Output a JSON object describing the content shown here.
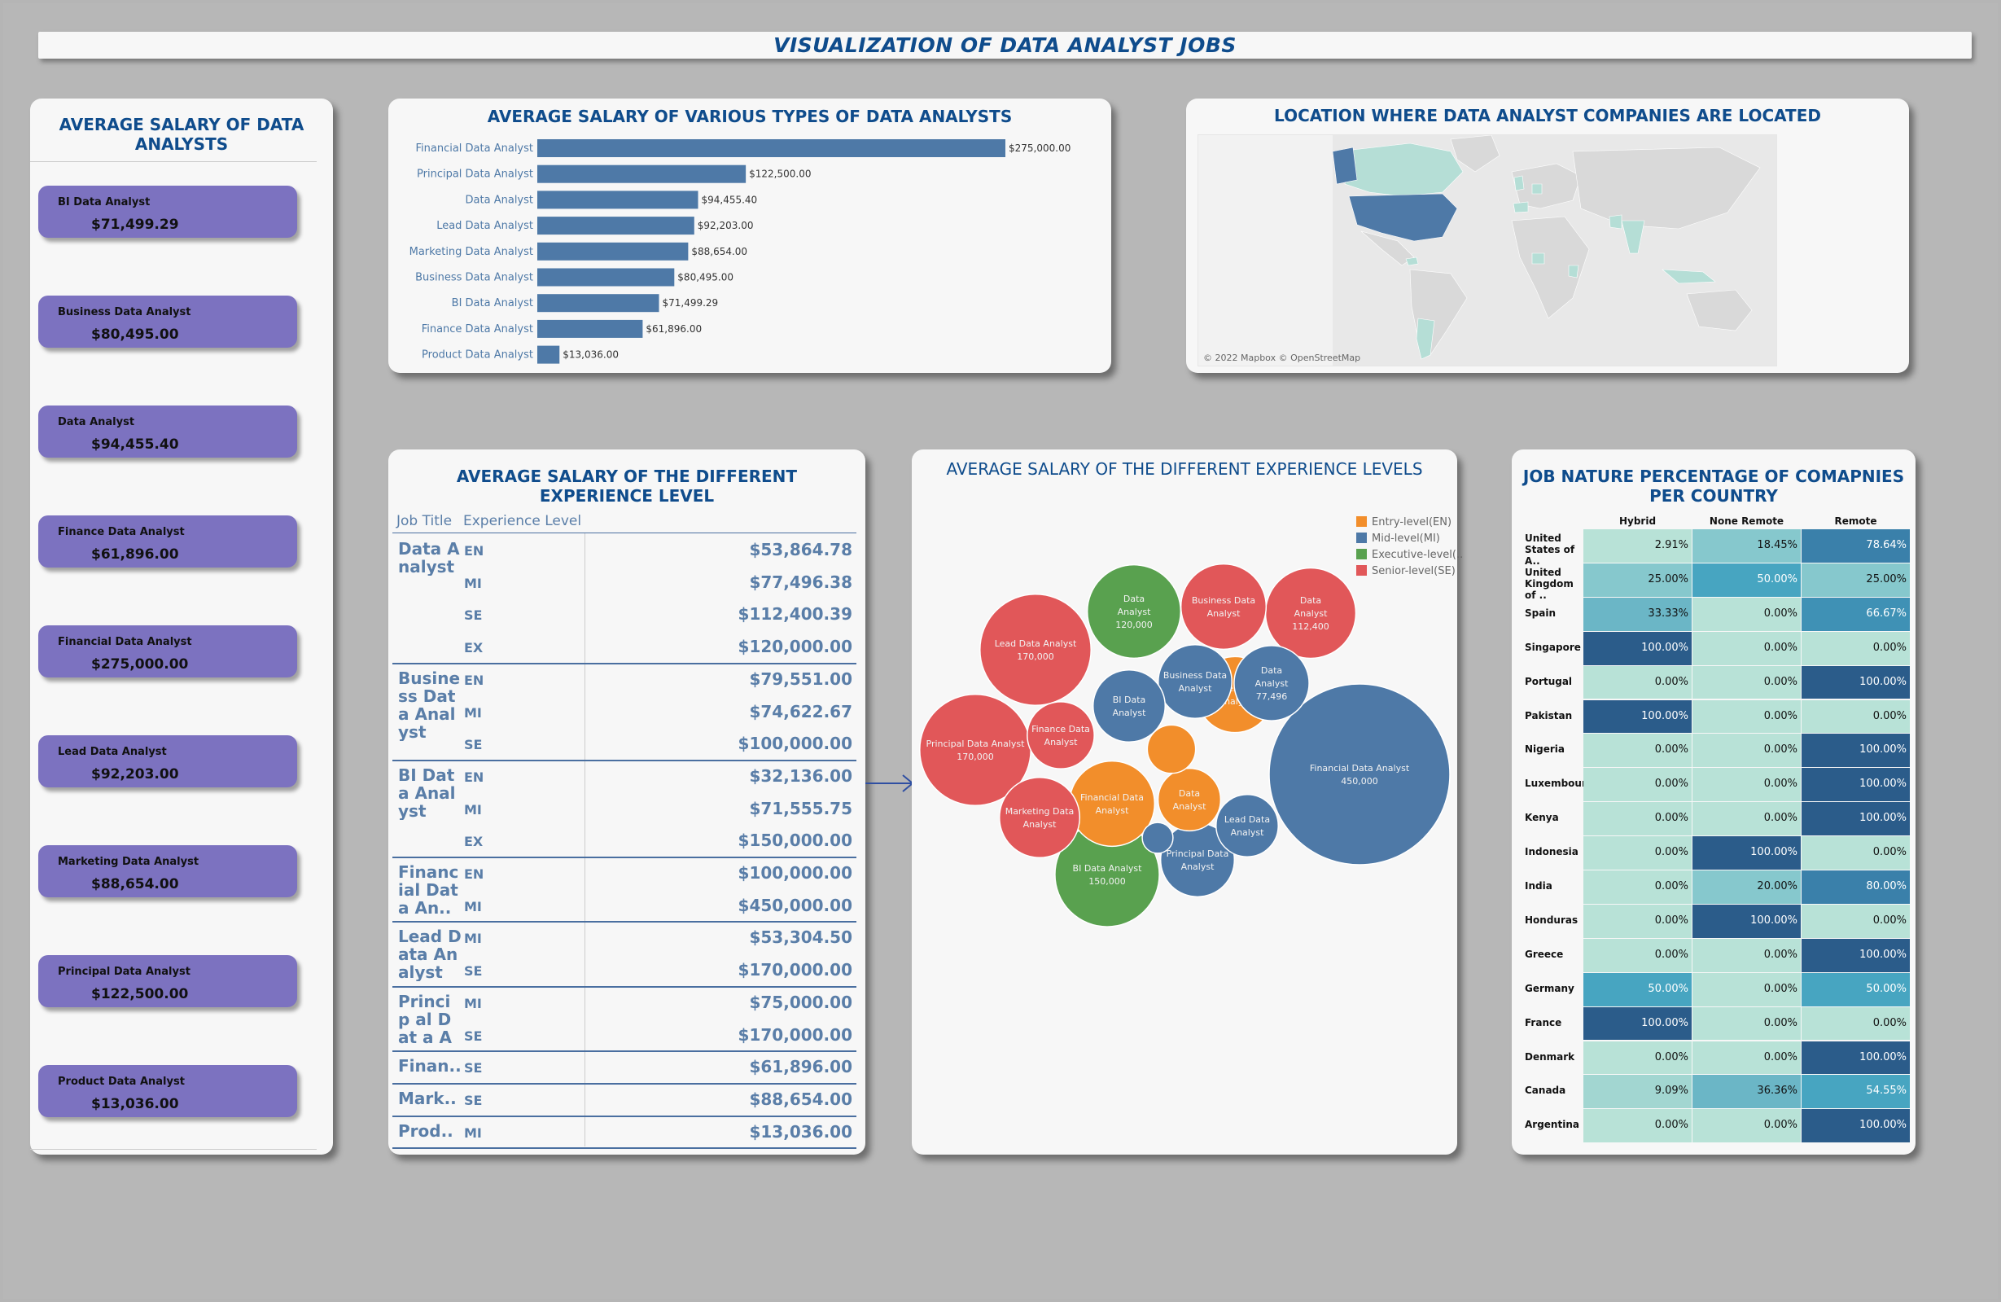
{
  "dashboard_title": "VISUALIZATION OF DATA ANALYST JOBS",
  "left_panel": {
    "title": "AVERAGE SALARY OF DATA ANALYSTS",
    "cards": [
      {
        "name": "BI Data Analyst",
        "value": "$71,499.29"
      },
      {
        "name": "Business Data Analyst",
        "value": "$80,495.00"
      },
      {
        "name": "Data Analyst",
        "value": "$94,455.40"
      },
      {
        "name": "Finance Data Analyst",
        "value": "$61,896.00"
      },
      {
        "name": "Financial Data Analyst",
        "value": "$275,000.00"
      },
      {
        "name": "Lead Data Analyst",
        "value": "$92,203.00"
      },
      {
        "name": "Marketing Data Analyst",
        "value": "$88,654.00"
      },
      {
        "name": "Principal Data Analyst",
        "value": "$122,500.00"
      },
      {
        "name": "Product Data Analyst",
        "value": "$13,036.00"
      }
    ]
  },
  "bar_panel": {
    "title": "AVERAGE SALARY OF VARIOUS TYPES OF DATA ANALYSTS"
  },
  "chart_data": [
    {
      "type": "bar",
      "orientation": "horizontal",
      "title": "AVERAGE SALARY OF VARIOUS TYPES OF DATA ANALYSTS",
      "categories": [
        "Financial Data Analyst",
        "Principal Data Analyst",
        "Data Analyst",
        "Lead Data Analyst",
        "Marketing Data Analyst",
        "Business Data Analyst",
        "BI Data Analyst",
        "Finance Data Analyst",
        "Product Data Analyst"
      ],
      "values": [
        275000,
        122500,
        94455.4,
        92203,
        88654,
        80495,
        71499.29,
        61896,
        13036
      ],
      "value_labels": [
        "$275,000.00",
        "$122,500.00",
        "$94,455.40",
        "$92,203.00",
        "$88,654.00",
        "$80,495.00",
        "$71,499.29",
        "$61,896.00",
        "$13,036.00"
      ],
      "color": "#4e79a7",
      "xlim": [
        0,
        275000
      ]
    },
    {
      "type": "scatter",
      "subtype": "packed-bubble",
      "title": "AVERAGE SALARY OF THE DIFFERENT EXPERIENCE LEVELS",
      "legend": [
        {
          "label": "Entry-level(EN)",
          "color": "#f28e2b"
        },
        {
          "label": "Mid-level(MI)",
          "color": "#4e79a7"
        },
        {
          "label": "Executive-level(..",
          "color": "#59a14f"
        },
        {
          "label": "Senior-level(SE)",
          "color": "#e15759"
        }
      ],
      "legend_position": "top-right",
      "bubbles": [
        {
          "label": "Financial Data Analyst",
          "value_label": "450,000",
          "value": 450000,
          "level": "MI"
        },
        {
          "label": "Principal Data Analyst",
          "value_label": "170,000",
          "value": 170000,
          "level": "SE"
        },
        {
          "label": "Lead Data Analyst",
          "value_label": "170,000",
          "value": 170000,
          "level": "SE"
        },
        {
          "label": "BI Data Analyst",
          "value_label": "150,000",
          "value": 150000,
          "level": "EX"
        },
        {
          "label": "Data Analyst",
          "value_label": "120,000",
          "value": 120000,
          "level": "EX"
        },
        {
          "label": "Data Analyst",
          "value_label": "112,400",
          "value": 112400,
          "level": "SE"
        },
        {
          "label": "Business Data Analyst",
          "value_label": "",
          "value": 100000,
          "level": "SE"
        },
        {
          "label": "Financial Data Analyst",
          "value_label": "",
          "value": 100000,
          "level": "EN"
        },
        {
          "label": "Business Data Analyst",
          "value_label": "",
          "value": 79551,
          "level": "EN"
        },
        {
          "label": "Data Analyst",
          "value_label": "77,496",
          "value": 77496,
          "level": "MI"
        },
        {
          "label": "Principal Data Analyst",
          "value_label": "",
          "value": 75000,
          "level": "MI"
        },
        {
          "label": "Business Data Analyst",
          "value_label": "",
          "value": 74623,
          "level": "MI"
        },
        {
          "label": "BI Data Analyst",
          "value_label": "",
          "value": 71556,
          "level": "MI"
        },
        {
          "label": "Marketing Data Analyst",
          "value_label": "",
          "value": 88654,
          "level": "SE"
        },
        {
          "label": "Finance Data Analyst",
          "value_label": "",
          "value": 61896,
          "level": "SE"
        },
        {
          "label": "Lead Data Analyst",
          "value_label": "",
          "value": 53305,
          "level": "MI"
        },
        {
          "label": "Data Analyst",
          "value_label": "",
          "value": 53865,
          "level": "EN"
        },
        {
          "label": "",
          "value_label": "",
          "value": 32136,
          "level": "EN"
        },
        {
          "label": "",
          "value_label": "",
          "value": 13036,
          "level": "MI"
        }
      ]
    },
    {
      "type": "heatmap",
      "title": "JOB NATURE PERCENTAGE OF COMAPNIES PER COUNTRY",
      "columns": [
        "Hybrid",
        "None Remote",
        "Remote"
      ],
      "rows": [
        {
          "country": "United States of A..",
          "values": [
            2.91,
            18.45,
            78.64
          ],
          "labels": [
            "2.91%",
            "18.45%",
            "78.64%"
          ]
        },
        {
          "country": "United Kingdom of ..",
          "values": [
            25.0,
            50.0,
            25.0
          ],
          "labels": [
            "25.00%",
            "50.00%",
            "25.00%"
          ]
        },
        {
          "country": "Spain",
          "values": [
            33.33,
            0.0,
            66.67
          ],
          "labels": [
            "33.33%",
            "0.00%",
            "66.67%"
          ]
        },
        {
          "country": "Singapore",
          "values": [
            100.0,
            0.0,
            0.0
          ],
          "labels": [
            "100.00%",
            "0.00%",
            "0.00%"
          ]
        },
        {
          "country": "Portugal",
          "values": [
            0.0,
            0.0,
            100.0
          ],
          "labels": [
            "0.00%",
            "0.00%",
            "100.00%"
          ]
        },
        {
          "country": "Pakistan",
          "values": [
            100.0,
            0.0,
            0.0
          ],
          "labels": [
            "100.00%",
            "0.00%",
            "0.00%"
          ]
        },
        {
          "country": "Nigeria",
          "values": [
            0.0,
            0.0,
            100.0
          ],
          "labels": [
            "0.00%",
            "0.00%",
            "100.00%"
          ]
        },
        {
          "country": "Luxembourg",
          "values": [
            0.0,
            0.0,
            100.0
          ],
          "labels": [
            "0.00%",
            "0.00%",
            "100.00%"
          ]
        },
        {
          "country": "Kenya",
          "values": [
            0.0,
            0.0,
            100.0
          ],
          "labels": [
            "0.00%",
            "0.00%",
            "100.00%"
          ]
        },
        {
          "country": "Indonesia",
          "values": [
            0.0,
            100.0,
            0.0
          ],
          "labels": [
            "0.00%",
            "100.00%",
            "0.00%"
          ]
        },
        {
          "country": "India",
          "values": [
            0.0,
            20.0,
            80.0
          ],
          "labels": [
            "0.00%",
            "20.00%",
            "80.00%"
          ]
        },
        {
          "country": "Honduras",
          "values": [
            0.0,
            100.0,
            0.0
          ],
          "labels": [
            "0.00%",
            "100.00%",
            "0.00%"
          ]
        },
        {
          "country": "Greece",
          "values": [
            0.0,
            0.0,
            100.0
          ],
          "labels": [
            "0.00%",
            "0.00%",
            "100.00%"
          ]
        },
        {
          "country": "Germany",
          "values": [
            50.0,
            0.0,
            50.0
          ],
          "labels": [
            "50.00%",
            "0.00%",
            "50.00%"
          ]
        },
        {
          "country": "France",
          "values": [
            100.0,
            0.0,
            0.0
          ],
          "labels": [
            "100.00%",
            "0.00%",
            "0.00%"
          ]
        },
        {
          "country": "Denmark",
          "values": [
            0.0,
            0.0,
            100.0
          ],
          "labels": [
            "0.00%",
            "0.00%",
            "100.00%"
          ]
        },
        {
          "country": "Canada",
          "values": [
            9.09,
            36.36,
            54.55
          ],
          "labels": [
            "9.09%",
            "36.36%",
            "54.55%"
          ]
        },
        {
          "country": "Argentina",
          "values": [
            0.0,
            0.0,
            100.0
          ],
          "labels": [
            "0.00%",
            "0.00%",
            "100.00%"
          ]
        }
      ]
    }
  ],
  "map_panel": {
    "title": "LOCATION WHERE DATA ANALYST COMPANIES ARE LOCATED",
    "attribution": "© 2022 Mapbox © OpenStreetMap",
    "colors": {
      "land": "#d9d9d9",
      "highlight": "#b5ded6",
      "top": "#4e79a7"
    }
  },
  "experience_table": {
    "title": "AVERAGE SALARY OF THE DIFFERENT EXPERIENCE LEVEL",
    "col_job": "Job Title",
    "col_level": "Experience Level",
    "groups": [
      {
        "job": "Data A nalyst",
        "rows": [
          {
            "level": "EN",
            "value": "$53,864.78"
          },
          {
            "level": "MI",
            "value": "$77,496.38"
          },
          {
            "level": "SE",
            "value": "$112,400.39"
          },
          {
            "level": "EX",
            "value": "$120,000.00"
          }
        ]
      },
      {
        "job": "Busine ss Dat a Anal yst",
        "rows": [
          {
            "level": "EN",
            "value": "$79,551.00"
          },
          {
            "level": "MI",
            "value": "$74,622.67"
          },
          {
            "level": "SE",
            "value": "$100,000.00"
          }
        ]
      },
      {
        "job": "BI Dat a Anal yst",
        "rows": [
          {
            "level": "EN",
            "value": "$32,136.00"
          },
          {
            "level": "MI",
            "value": "$71,555.75"
          },
          {
            "level": "EX",
            "value": "$150,000.00"
          }
        ]
      },
      {
        "job": "Financ ial Dat a An..",
        "rows": [
          {
            "level": "EN",
            "value": "$100,000.00"
          },
          {
            "level": "MI",
            "value": "$450,000.00"
          }
        ]
      },
      {
        "job": "Lead D ata An alyst",
        "rows": [
          {
            "level": "MI",
            "value": "$53,304.50"
          },
          {
            "level": "SE",
            "value": "$170,000.00"
          }
        ]
      },
      {
        "job": "Princip al Dat a An..",
        "rows": [
          {
            "level": "MI",
            "value": "$75,000.00"
          },
          {
            "level": "SE",
            "value": "$170,000.00"
          }
        ]
      },
      {
        "job": "Finan..",
        "rows": [
          {
            "level": "SE",
            "value": "$61,896.00"
          }
        ]
      },
      {
        "job": "Mark..",
        "rows": [
          {
            "level": "SE",
            "value": "$88,654.00"
          }
        ]
      },
      {
        "job": "Prod..",
        "rows": [
          {
            "level": "MI",
            "value": "$13,036.00"
          }
        ]
      }
    ]
  },
  "bubble_panel": {
    "title": "AVERAGE SALARY OF THE DIFFERENT EXPERIENCE LEVELS"
  },
  "heatmap_panel": {
    "title": "JOB NATURE PERCENTAGE OF COMAPNIES PER COUNTRY"
  }
}
